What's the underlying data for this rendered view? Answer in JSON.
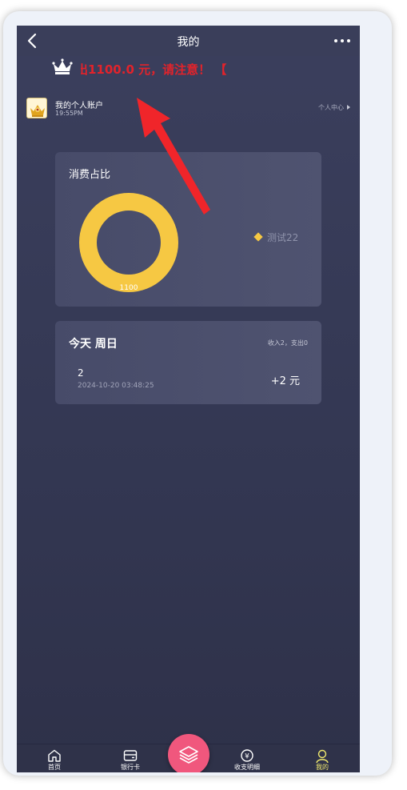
{
  "header": {
    "title": "我的"
  },
  "marquee": {
    "text": "出1100.0 元，请注意！          【"
  },
  "account": {
    "name": "我的个人账户",
    "time": "19:55PM",
    "center_link": "个人中心"
  },
  "pie_card": {
    "title": "消费占比",
    "chart_data": {
      "type": "pie",
      "title": "消费占比",
      "slices": [
        {
          "label": "测试22",
          "value": 1100,
          "color": "#f6c843"
        }
      ],
      "data_labels": [
        "1100"
      ]
    }
  },
  "today": {
    "title": "今天 周日",
    "summary": "收入2，支出0",
    "tx": {
      "name": "2",
      "time": "2024-10-20 03:48:25",
      "amount": "+2 元"
    }
  },
  "tabbar": {
    "home": "首页",
    "bank": "银行卡",
    "details": "收支明细",
    "me": "我的"
  },
  "colors": {
    "accent_red": "#e1232b",
    "donut": "#f6c843",
    "fab": "#f0577d",
    "active_tab": "#f1ea6e"
  }
}
